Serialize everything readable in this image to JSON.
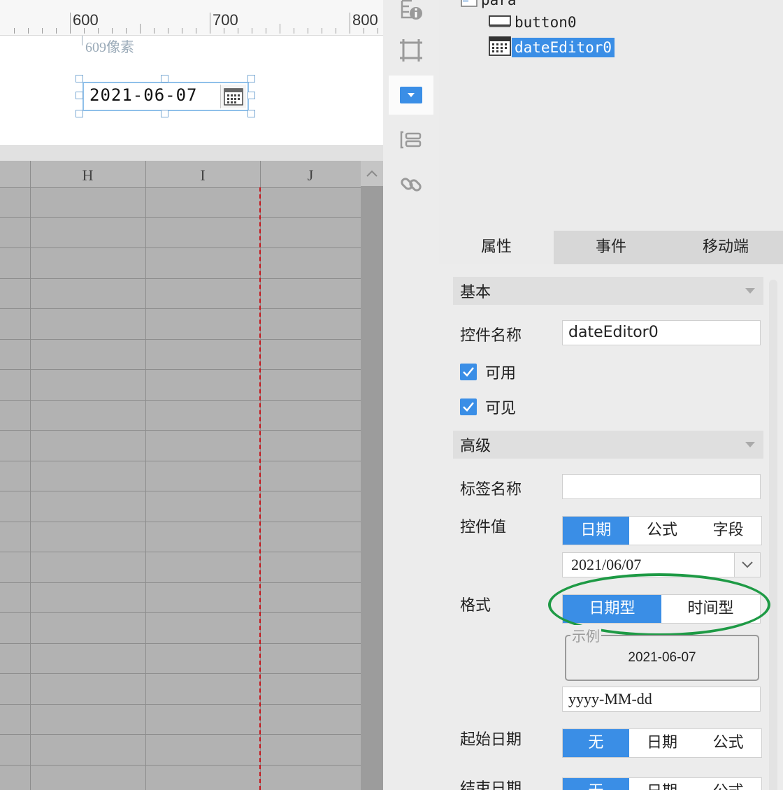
{
  "ruler": {
    "marks": [
      "600",
      "700",
      "800"
    ]
  },
  "canvas": {
    "pixel_label": "609像素",
    "widget_value": "2021-06-07"
  },
  "grid": {
    "columns": [
      "H",
      "I",
      "J"
    ]
  },
  "tree": {
    "parent_label": "para",
    "items": [
      {
        "label": "button0",
        "icon": "button-icon",
        "selected": false
      },
      {
        "label": "dateEditor0",
        "icon": "calendar-icon",
        "selected": true
      }
    ]
  },
  "tabs": [
    "属性",
    "事件",
    "移动端"
  ],
  "properties": {
    "basic_section": "基本",
    "widget_name_label": "控件名称",
    "widget_name_value": "dateEditor0",
    "enabled_label": "可用",
    "enabled": true,
    "visible_label": "可见",
    "visible": true,
    "advanced_section": "高级",
    "tag_name_label": "标签名称",
    "tag_name_value": "",
    "widget_value_label": "控件值",
    "widget_value_options": [
      "日期",
      "公式",
      "字段"
    ],
    "widget_value_selected": "日期",
    "date_value": "2021/06/07",
    "format_label": "格式",
    "format_options": [
      "日期型",
      "时间型"
    ],
    "format_selected": "日期型",
    "example_label": "示例",
    "example_value": "2021-06-07",
    "format_pattern": "yyyy-MM-dd",
    "start_date_label": "起始日期",
    "start_date_options": [
      "无",
      "日期",
      "公式"
    ],
    "start_date_selected": "无",
    "end_date_label": "结束日期",
    "end_date_options": [
      "无",
      "日期",
      "公式"
    ],
    "end_date_selected": "无"
  },
  "colors": {
    "accent": "#3a8ee6",
    "highlight": "#1e9a45",
    "guide": "#c4161c"
  }
}
